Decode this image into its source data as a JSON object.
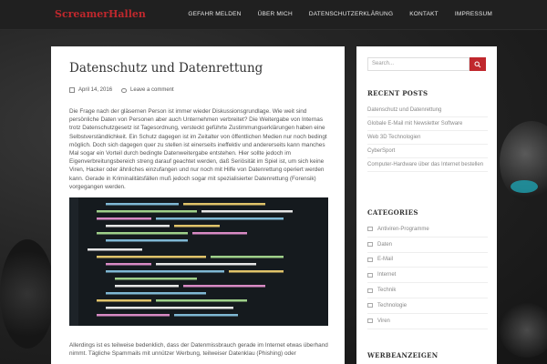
{
  "site": {
    "logo": "ScreamerHallen"
  },
  "nav": {
    "items": [
      "GEFAHR MELDEN",
      "ÜBER MICH",
      "DATENSCHUTZERKLÄRUNG",
      "KONTAKT",
      "IMPRESSUM"
    ]
  },
  "post": {
    "title": "Datenschutz und Datenrettung",
    "date": "April 14, 2016",
    "comment_link": "Leave a comment",
    "body": "Die Frage nach der gläsernen Person ist immer wieder Diskussionsgrundlage. Wie weit sind persönliche Daten von Personen aber auch Unternehmen verbreitet? Die Weitergabe von Internas trotz Datenschutzgesetz ist Tagesordnung, versteckt geführte Zustimmungserklärungen haben eine Selbstverständlichkeit. Ein Schutz dagegen ist im Zeitalter von öffentlichen Medien nur noch bedingt möglich. Doch sich dagegen quer zu stellen ist einerseits ineffektiv und andererseits kann manches Mal sogar ein Vorteil durch  bedingte Datenweitergabe entstehen. Hier sollte jedoch im Eigenverbreitungsbereich streng darauf geachtet werden, daß Seriösität im Spiel ist, um sich keine Viren, Hacker oder ähnliches einzufangen und nur noch mit Hilfe von Datenrettung operiert werden kann. Gerade in Kriminalitätsfällen muß jedoch sogar mit spezialisierter Datenrettung (Forensik) vorgegangen werden.",
    "after_image": "Allerdings ist es teilweise bedenklich, dass der Datenmissbrauch gerade im Internet etwas überhand nimmt. Tägliche Spammails mit unnützer Werbung, teilweiser Datenklau (Phishing) oder"
  },
  "sidebar": {
    "search_placeholder": "Search...",
    "recent_title": "RECENT POSTS",
    "recent_posts": [
      "Datenschutz und Datenrettung",
      "Globale E-Mail mit Newsletter Software",
      "Web 3D Technologien",
      "CyberSport",
      "Computer-Hardware über das Internet bestellen"
    ],
    "categories_title": "CATEGORIES",
    "categories": [
      "Antiviren-Programme",
      "Daten",
      "E-Mail",
      "Internet",
      "Technik",
      "Technologie",
      "Viren"
    ],
    "ads_title": "WERBEANZEIGEN"
  },
  "colors": {
    "accent": "#c0282d",
    "header_bg": "#202020",
    "code_bg": "#151a1e"
  },
  "icons": {
    "date": "calendar-icon",
    "comment": "comment-icon",
    "search": "search-icon",
    "category": "folder-icon"
  }
}
